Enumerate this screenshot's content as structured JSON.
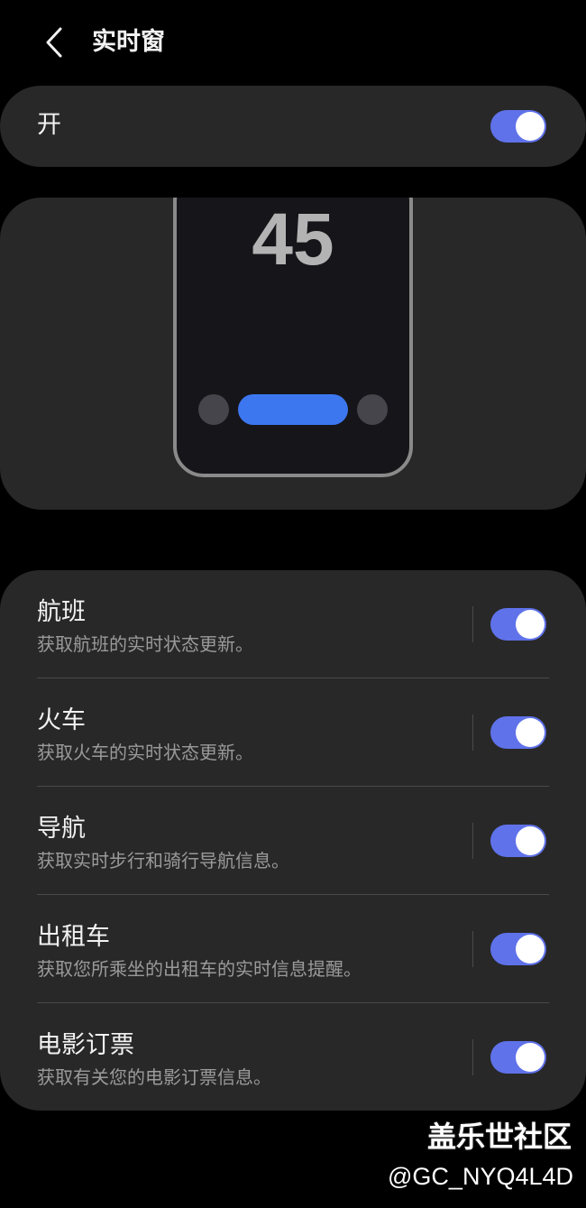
{
  "header": {
    "title": "实时窗",
    "back_icon": "chevron-left-icon"
  },
  "master": {
    "label": "开",
    "enabled": true
  },
  "preview": {
    "number": "45"
  },
  "items": [
    {
      "title": "航班",
      "desc": "获取航班的实时状态更新。",
      "enabled": true
    },
    {
      "title": "火车",
      "desc": "获取火车的实时状态更新。",
      "enabled": true
    },
    {
      "title": "导航",
      "desc": "获取实时步行和骑行导航信息。",
      "enabled": true
    },
    {
      "title": "出租车",
      "desc": "获取您所乘坐的出租车的实时信息提醒。",
      "enabled": true
    },
    {
      "title": "电影订票",
      "desc": "获取有关您的电影订票信息。",
      "enabled": true
    }
  ],
  "watermark": {
    "site": "盖乐世社区",
    "user": "@GC_NYQ4L4D"
  },
  "colors": {
    "background": "#000000",
    "card": "#282828",
    "toggle_on": "#5f72ea",
    "accent_pill": "#3c77f0",
    "secondary_text": "#9a9a9a"
  }
}
